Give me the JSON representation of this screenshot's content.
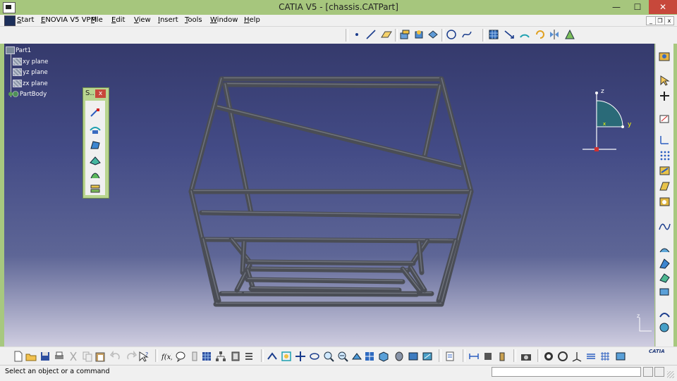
{
  "window": {
    "title": "CATIA V5 - [chassis.CATPart]",
    "close_glyph": "✕",
    "minimize_glyph": "—",
    "maximize_glyph": "☐"
  },
  "menubar": {
    "items": [
      {
        "id": "start",
        "label": "Start"
      },
      {
        "id": "enovia",
        "label": "ENOVIA V5 VPM"
      },
      {
        "id": "file",
        "label": "File"
      },
      {
        "id": "edit",
        "label": "Edit"
      },
      {
        "id": "view",
        "label": "View"
      },
      {
        "id": "insert",
        "label": "Insert"
      },
      {
        "id": "tools",
        "label": "Tools"
      },
      {
        "id": "window",
        "label": "Window"
      },
      {
        "id": "help",
        "label": "Help"
      }
    ],
    "mdi_min": "_",
    "mdi_restore": "❐",
    "mdi_close": "x"
  },
  "spec_tree": {
    "root": "Part1",
    "items": [
      {
        "label": "xy plane",
        "icon": "plane-icon"
      },
      {
        "label": "yz plane",
        "icon": "plane-icon"
      },
      {
        "label": "zx plane",
        "icon": "plane-icon"
      },
      {
        "label": "PartBody",
        "icon": "partbody-icon"
      }
    ]
  },
  "floating_toolbar": {
    "title": "S..",
    "close": "x"
  },
  "compass": {
    "z": "z",
    "y": "y",
    "x": "x"
  },
  "axis_triad": {
    "z": "z"
  },
  "bottom_toolbar": {
    "logo": "CATIA"
  },
  "status": {
    "prompt": "Select an object or a command",
    "command_value": ""
  },
  "colors": {
    "accent": "#a6c67d",
    "close": "#c7483b",
    "frame": "#4a4d55",
    "viewport_top": "#353a6c",
    "viewport_bottom": "#cfcde0"
  }
}
